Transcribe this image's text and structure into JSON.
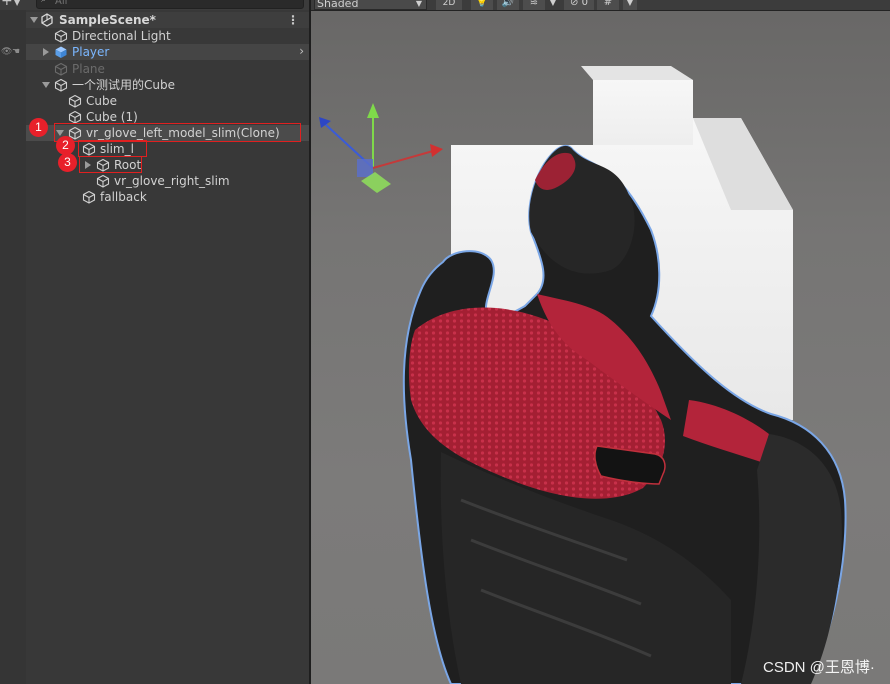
{
  "hierarchy": {
    "search_placeholder": "All",
    "scene_name": "SampleScene*",
    "items": [
      {
        "label": "Directional Light"
      },
      {
        "label": "Player"
      },
      {
        "label": "Plane"
      },
      {
        "label": "一个测试用的Cube"
      },
      {
        "label": "Cube"
      },
      {
        "label": "Cube (1)"
      },
      {
        "label": "vr_glove_left_model_slim(Clone)"
      },
      {
        "label": "slim_l"
      },
      {
        "label": "Root"
      },
      {
        "label": "vr_glove_right_slim"
      },
      {
        "label": "fallback"
      }
    ],
    "selected_item": "Player"
  },
  "annotations": [
    "1",
    "2",
    "3"
  ],
  "scene_toolbar": {
    "shading_mode": "Shaded",
    "mode_2d": "2D",
    "hidden_count": "0"
  },
  "icons": {
    "create": "plus-icon",
    "search": "search-icon",
    "scene": "unity-scene-icon",
    "gameobject": "cube-icon",
    "prefab": "prefab-cube-icon",
    "visibility": "eye-icon",
    "pickability": "hand-icon",
    "lighting": "light-bulb-icon",
    "audio": "speaker-icon",
    "effects": "layers-icon",
    "hidden": "eye-slash-icon",
    "grid": "grid-icon"
  },
  "colors": {
    "accent_prefab": "#7bb7ff",
    "annotation_red": "#e8202a",
    "panel_bg": "#383838",
    "glove_red": "#b8263a"
  },
  "watermark": "CSDN @王恩博·"
}
